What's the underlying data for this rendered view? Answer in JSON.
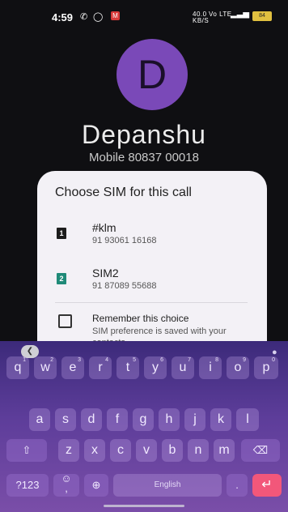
{
  "status_bar": {
    "time": "4:59",
    "call_icon": "phone-icon",
    "whatsapp_icon": "whatsapp-icon",
    "app_badge": "M",
    "net_speed_top": "40.0",
    "net_speed_bottom": "KB/S",
    "volte": "Vo LTE",
    "signal": "4G",
    "battery": "84"
  },
  "contact": {
    "initial": "D",
    "name": "Depanshu",
    "mobile": "Mobile 80837 00018"
  },
  "dialog": {
    "title": "Choose SIM for this call",
    "sims": [
      {
        "slot": "1",
        "name": "#klm",
        "number": "91 93061 16168",
        "color": "#1c1c1c"
      },
      {
        "slot": "2",
        "name": "SIM2",
        "number": "91 87089 55688",
        "color": "#1f8a78"
      }
    ],
    "remember_title": "Remember this choice",
    "remember_sub": "SIM preference is saved with your contacts."
  },
  "keyboard": {
    "row1": [
      {
        "k": "q",
        "h": "1"
      },
      {
        "k": "w",
        "h": "2"
      },
      {
        "k": "e",
        "h": "3"
      },
      {
        "k": "r",
        "h": "4"
      },
      {
        "k": "t",
        "h": "5"
      },
      {
        "k": "y",
        "h": "6"
      },
      {
        "k": "u",
        "h": "7"
      },
      {
        "k": "i",
        "h": "8"
      },
      {
        "k": "o",
        "h": "9"
      },
      {
        "k": "p",
        "h": "0"
      }
    ],
    "row2": [
      "a",
      "s",
      "d",
      "f",
      "g",
      "h",
      "j",
      "k",
      "l"
    ],
    "row3": [
      "z",
      "x",
      "c",
      "v",
      "b",
      "n",
      "m"
    ],
    "shift": "⇧",
    "backspace": "⌫",
    "symbols": "?123",
    "emoji_top": "☺",
    "comma": ",",
    "globe": "globe-icon",
    "space": "English",
    "period": ".",
    "enter": "↵"
  }
}
